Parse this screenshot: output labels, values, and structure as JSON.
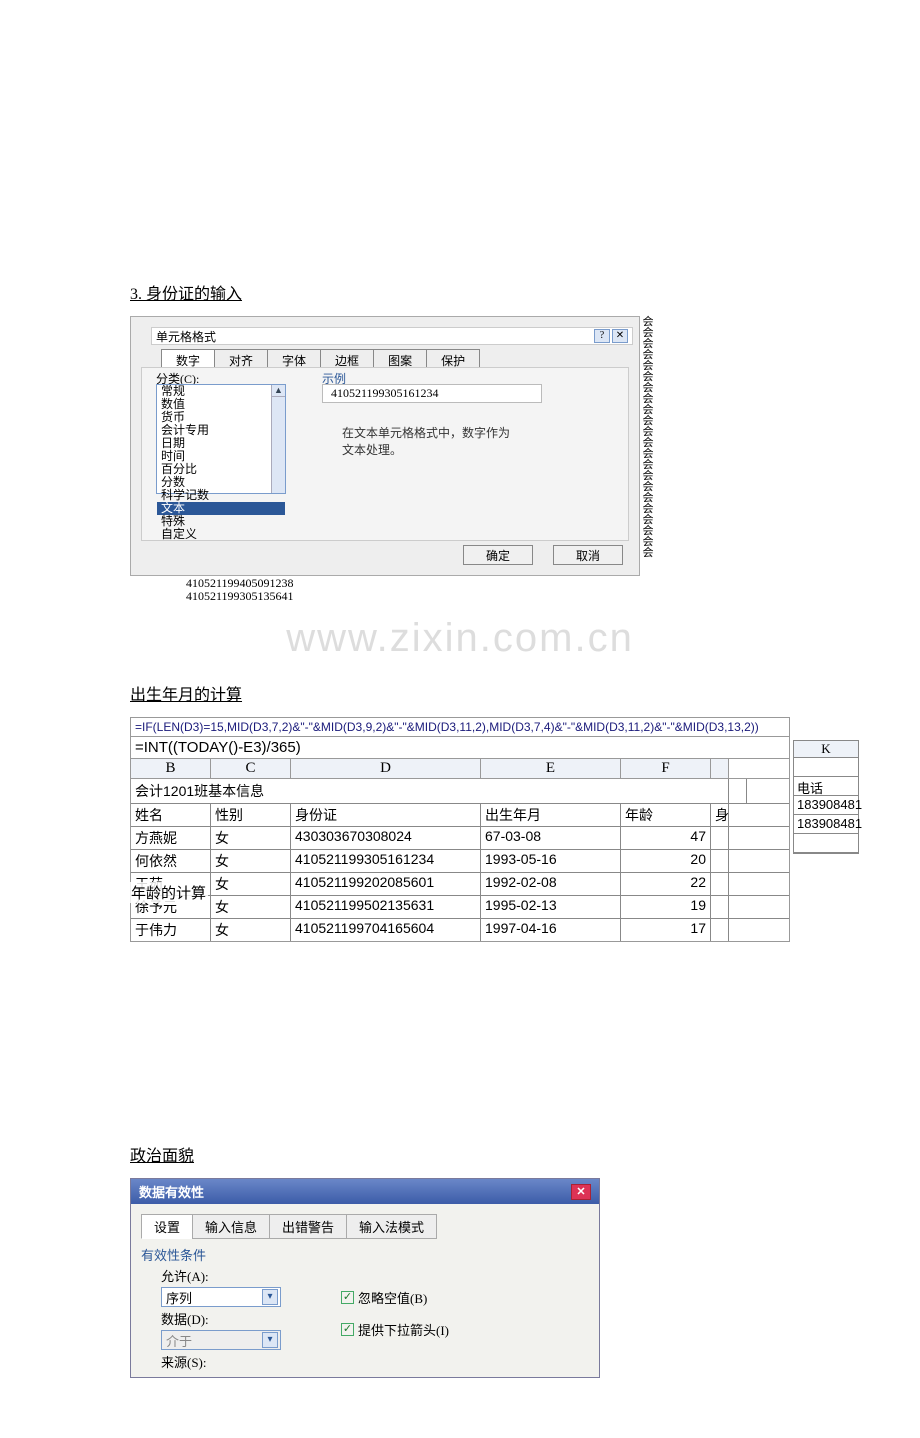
{
  "section1_title": "3. 身份证的输入",
  "fmt_dialog": {
    "title": "单元格格式",
    "help_btn": "?",
    "close_btn": "✕",
    "tabs": [
      "数字",
      "对齐",
      "字体",
      "边框",
      "图案",
      "保护"
    ],
    "active_tab": 0,
    "category_label": "分类(C):",
    "categories": [
      "常规",
      "数值",
      "货币",
      "会计专用",
      "日期",
      "时间",
      "百分比",
      "分数",
      "科学记数",
      "文本",
      "特殊",
      "自定义"
    ],
    "selected_category_index": 9,
    "example_label": "示例",
    "example_value": "410521199305161234",
    "desc1": "在文本单元格格式中，数字作为",
    "desc2": "文本处理。",
    "ok": "确定",
    "cancel": "取消",
    "below1": "410521199405091238",
    "below2": "410521199305135641",
    "hui_char": "会"
  },
  "watermark": "www.zixin.com.cn",
  "section2_title": "出生年月的计算",
  "sheet": {
    "formula1": "=IF(LEN(D3)=15,MID(D3,7,2)&\"-\"&MID(D3,9,2)&\"-\"&MID(D3,11,2),MID(D3,7,4)&\"-\"&MID(D3,11,2)&\"-\"&MID(D3,13,2))",
    "formula2": "=INT((TODAY()-E3)/365)",
    "col_headers": [
      "B",
      "C",
      "D",
      "E",
      "F"
    ],
    "title_row": "会计1201班基本信息",
    "header_row": [
      "姓名",
      "性别",
      "身份证",
      "出生年月",
      "年龄",
      "身"
    ],
    "rows": [
      [
        "方燕妮",
        "女",
        "430303670308024",
        "67-03-08",
        "47",
        ""
      ],
      [
        "何依然",
        "女",
        "410521199305161234",
        "1993-05-16",
        "20",
        ""
      ],
      [
        "王茹",
        "女",
        "410521199202085601",
        "1992-02-08",
        "22",
        ""
      ],
      [
        "徐予元",
        "女",
        "410521199502135631",
        "1995-02-13",
        "19",
        ""
      ],
      [
        "于伟力",
        "女",
        "410521199704165604",
        "1997-04-16",
        "17",
        ""
      ]
    ],
    "overlay_age": "年龄的计算",
    "side_k_header": "K",
    "side_k": [
      "电话",
      "183908481",
      "183908481",
      ""
    ]
  },
  "section3_title": "政治面貌",
  "dv": {
    "title": "数据有效性",
    "close": "✕",
    "tabs": [
      "设置",
      "输入信息",
      "出错警告",
      "输入法模式"
    ],
    "active_tab": 0,
    "cond_label": "有效性条件",
    "allow_label": "允许(A):",
    "allow_value": "序列",
    "cb_ignore": "忽略空值(B)",
    "data_label": "数据(D):",
    "data_value": "介于",
    "cb_dropdown": "提供下拉箭头(I)",
    "source_label": "来源(S):"
  }
}
